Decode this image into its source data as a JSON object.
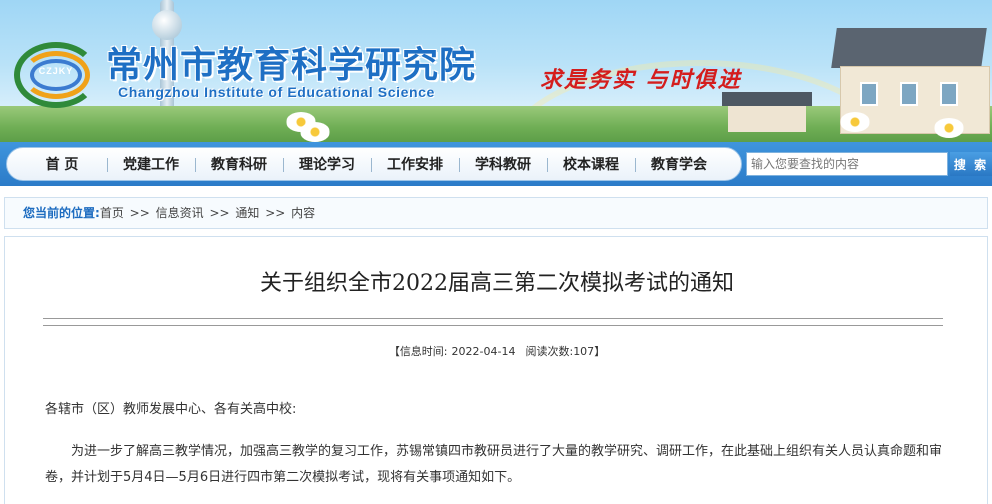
{
  "header": {
    "logo_abbr": "CZJKY",
    "title": "常州市教育科学研究院",
    "subtitle": "Changzhou Institute of Educational Science",
    "slogan": "求是务实  与时俱进"
  },
  "nav": {
    "items": [
      {
        "label": "首  页"
      },
      {
        "label": "党建工作"
      },
      {
        "label": "教育科研"
      },
      {
        "label": "理论学习"
      },
      {
        "label": "工作安排"
      },
      {
        "label": "学科教研"
      },
      {
        "label": "校本课程"
      },
      {
        "label": "教育学会"
      }
    ]
  },
  "search": {
    "placeholder": "输入您要查找的内容",
    "button_label": "搜 索"
  },
  "breadcrumb": {
    "lead": "您当前的位置:",
    "items": [
      "首页",
      "信息资讯",
      "通知",
      "内容"
    ],
    "separator": ">>"
  },
  "article": {
    "title": "关于组织全市2022届高三第二次模拟考试的通知",
    "meta": {
      "open": "【",
      "time_label": "信息时间:",
      "time_value": "2022-04-14",
      "views_label": "阅读次数:",
      "views_value": "107",
      "close": "】"
    },
    "salutation": "各辖市（区）教师发展中心、各有关高中校:",
    "body": "为进一步了解高三教学情况，加强高三教学的复习工作，苏锡常镇四市教研员进行了大量的教学研究、调研工作，在此基础上组织有关人员认真命题和审卷，并计划于5月4日—5月6日进行四市第二次模拟考试，现将有关事项通知如下。"
  },
  "colors": {
    "nav_blue": "#2b7bc8",
    "title_blue": "#1e6fc4",
    "slogan_red": "#d41d1d"
  }
}
